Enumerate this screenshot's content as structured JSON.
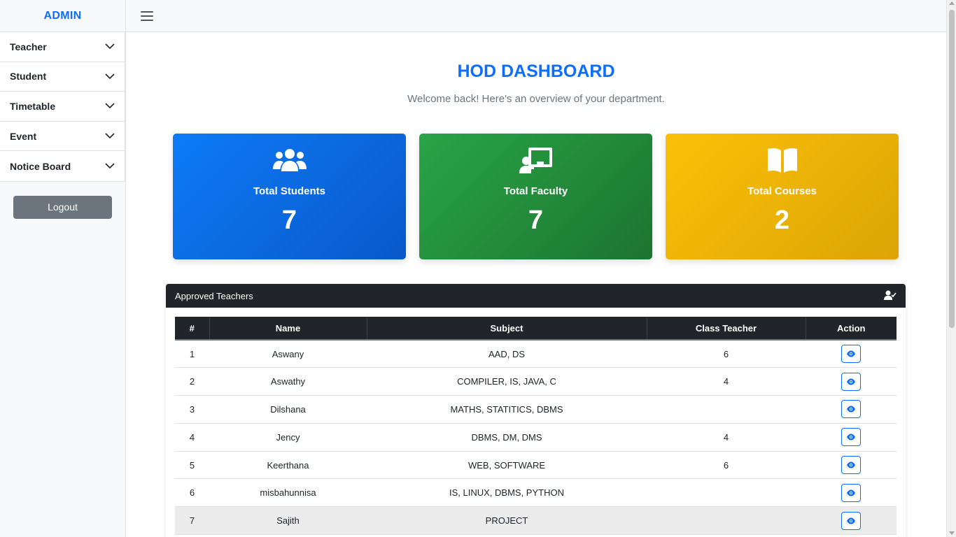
{
  "sidebar": {
    "brand": "ADMIN",
    "items": [
      {
        "label": "Teacher",
        "icon": "chevron-down-icon"
      },
      {
        "label": "Student",
        "icon": "chevron-down-icon"
      },
      {
        "label": "Timetable",
        "icon": "chevron-down-icon"
      },
      {
        "label": "Event",
        "icon": "chevron-down-icon"
      },
      {
        "label": "Notice Board",
        "icon": "chevron-down-icon"
      }
    ],
    "logout_label": "Logout"
  },
  "topbar": {
    "menu_icon": "hamburger-icon"
  },
  "header": {
    "title": "HOD DASHBOARD",
    "subtitle": "Welcome back! Here's an overview of your department."
  },
  "cards": [
    {
      "label": "Total Students",
      "value": "7",
      "icon": "users-icon",
      "color": "#0d6efd"
    },
    {
      "label": "Total Faculty",
      "value": "7",
      "icon": "chalkboard-teacher-icon",
      "color": "#28a745"
    },
    {
      "label": "Total Courses",
      "value": "2",
      "icon": "book-open-icon",
      "color": "#ffc107"
    }
  ],
  "teachers_panel": {
    "title": "Approved Teachers",
    "icon": "user-check-icon",
    "columns": [
      "#",
      "Name",
      "Subject",
      "Class Teacher",
      "Action"
    ],
    "rows": [
      {
        "num": "1",
        "name": "Aswany",
        "subject": "AAD, DS",
        "class_teacher": "6"
      },
      {
        "num": "2",
        "name": "Aswathy",
        "subject": "COMPILER, IS, JAVA, C",
        "class_teacher": "4"
      },
      {
        "num": "3",
        "name": "Dilshana",
        "subject": "MATHS, STATITICS, DBMS",
        "class_teacher": ""
      },
      {
        "num": "4",
        "name": "Jency",
        "subject": "DBMS, DM, DMS",
        "class_teacher": "4"
      },
      {
        "num": "5",
        "name": "Keerthana",
        "subject": "WEB, SOFTWARE",
        "class_teacher": "6"
      },
      {
        "num": "6",
        "name": "misbahunnisa",
        "subject": "IS, LINUX, DBMS, PYTHON",
        "class_teacher": ""
      },
      {
        "num": "7",
        "name": "Sajith",
        "subject": "PROJECT",
        "class_teacher": ""
      }
    ],
    "action_icon": "eye-icon"
  },
  "colors": {
    "accent": "#0d6efd",
    "dark": "#212529",
    "muted": "#6c757d"
  }
}
